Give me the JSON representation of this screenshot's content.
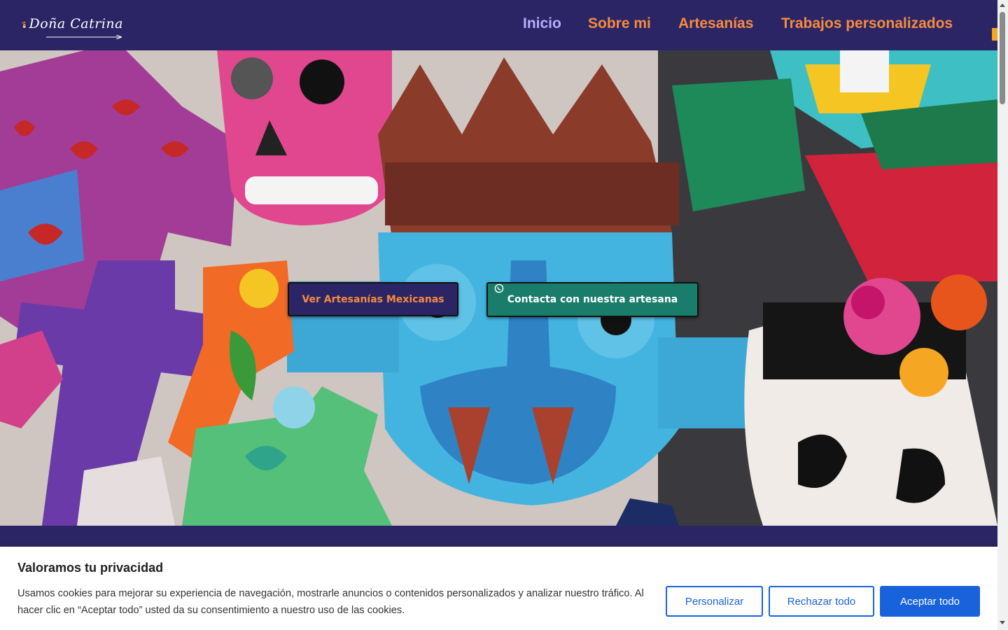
{
  "header": {
    "logo_text": "Doña Catrina",
    "nav": [
      {
        "label": "Inicio",
        "active": true
      },
      {
        "label": "Sobre mi",
        "active": false
      },
      {
        "label": "Artesanías",
        "active": false
      },
      {
        "label": "Trabajos personalizados",
        "active": false
      }
    ]
  },
  "hero": {
    "primary_button": "Ver Artesanías Mexicanas",
    "secondary_button": "Contacta con nuestra artesana",
    "secondary_icon": "whatsapp-icon"
  },
  "cookie_banner": {
    "title": "Valoramos tu privacidad",
    "text": "Usamos cookies para mejorar su experiencia de navegación, mostrarle anuncios o contenidos personalizados y analizar nuestro tráfico. Al hacer clic en “Aceptar todo” usted da su consentimiento a nuestro uso de las cookies.",
    "customize_label": "Personalizar",
    "reject_label": "Rechazar todo",
    "accept_label": "Aceptar todo"
  },
  "colors": {
    "header_bg": "#2c2565",
    "nav_text": "#f58b3d",
    "nav_active": "#b9acff",
    "teal_button": "#1a7c6a",
    "cookie_accent": "#1863dc"
  }
}
